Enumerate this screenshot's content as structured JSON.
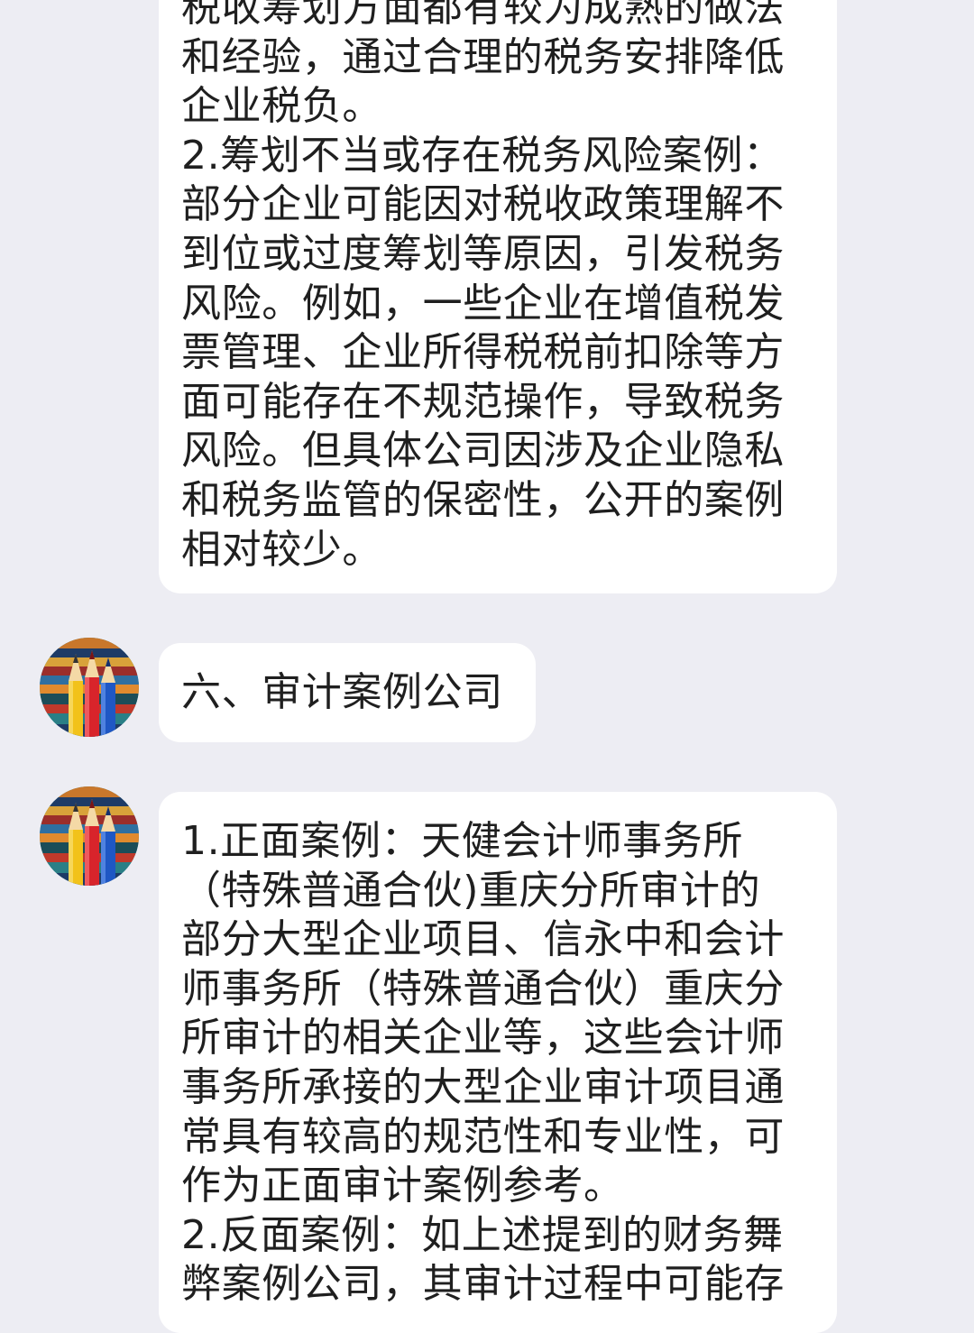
{
  "messages": [
    {
      "lines": [
        "税收筹划方面都有较为成熟的做法",
        "和经验，通过合理的税务安排降低",
        "企业税负。",
        "2.筹划不当或存在税务风险案例：",
        "部分企业可能因对税收政策理解不",
        "到位或过度筹划等原因，引发税务",
        "风险。例如，一些企业在增值税发",
        "票管理、企业所得税税前扣除等方",
        "面可能存在不规范操作，导致税务",
        "风险。但具体公司因涉及企业隐私",
        "和税务监管的保密性，公开的案例",
        "相对较少。"
      ]
    },
    {
      "lines": [
        "六、审计案例公司"
      ]
    },
    {
      "lines": [
        "1.正面案例：天健会计师事务所",
        "（特殊普通合伙)重庆分所审计的",
        "部分大型企业项目、信永中和会计",
        "师事务所（特殊普通合伙）重庆分",
        "所审计的相关企业等，这些会计师",
        "事务所承接的大型企业审计项目通",
        "常具有较高的规范性和专业性，可",
        "作为正面审计案例参考。",
        "2.反面案例：如上述提到的财务舞",
        "弊案例公司，其审计过程中可能存"
      ]
    }
  ],
  "avatar": {
    "icon": "colored-pencils-icon",
    "colors": {
      "pencil_yellow": "#f2c21a",
      "pencil_red": "#d8242b",
      "pencil_blue": "#1f57c4"
    }
  },
  "colors": {
    "background": "#ededf3",
    "bubble": "#ffffff",
    "text": "#1f1f1f"
  }
}
